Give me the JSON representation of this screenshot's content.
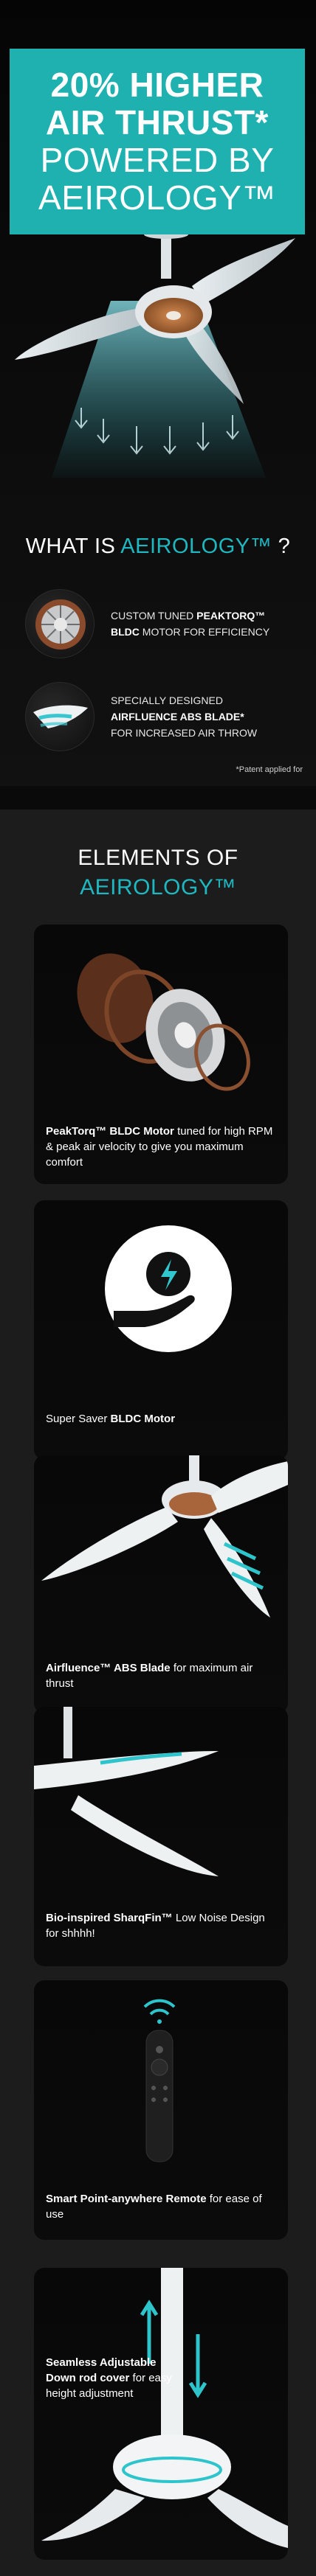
{
  "hero": {
    "title_line1": "20% HIGHER",
    "title_line2": "AIR THRUST*",
    "title_line3": "POWERED BY",
    "title_line4": "AEIROLOGY™",
    "brand_color": "#1fb0b0"
  },
  "what_is": {
    "prefix": "WHAT IS ",
    "accent": "AEIROLOGY™",
    "suffix": " ?",
    "features": [
      {
        "line1": "CUSTOM TUNED ",
        "bold1": "PEAKTORQ™",
        "bold2": "BLDC",
        "line2": " MOTOR FOR EFFICIENCY",
        "icon": "motor-icon"
      },
      {
        "line1": "SPECIALLY DESIGNED",
        "bold2": "AIRFLUENCE ABS BLADE*",
        "line3": "FOR INCREASED AIR THROW",
        "icon": "blade-icon"
      }
    ],
    "patent_note": "*Patent applied for"
  },
  "elements": {
    "heading_line1": "ELEMENTS OF",
    "heading_line2": "AEIROLOGY™",
    "cards": [
      {
        "bold": "PeakTorq™ BLDC Motor",
        "text": " tuned for high RPM & peak air velocity to give you maximum comfort",
        "icon": "motor-exploded-icon"
      },
      {
        "prefix": "Super Saver ",
        "bold": "BLDC Motor",
        "icon": "energy-saving-hand-icon"
      },
      {
        "bold": "Airfluence™ ABS Blade",
        "text": " for maximum air thrust",
        "icon": "fan-blade-icon"
      },
      {
        "bold": "Bio-inspired SharqFin™",
        "text": " Low Noise Design for shhhh!",
        "icon": "sharqfin-blade-icon"
      },
      {
        "bold": "Smart Point-anywhere Remote",
        "text": " for ease of use",
        "icon": "remote-icon"
      },
      {
        "bold": "Seamless Adjustable Down rod cover",
        "text": " for easy height adjustment",
        "icon": "downrod-icon"
      }
    ]
  },
  "colors": {
    "accent": "#1fb8c0",
    "bg": "#0a0a0a",
    "section_bg": "#1c1c1c"
  }
}
